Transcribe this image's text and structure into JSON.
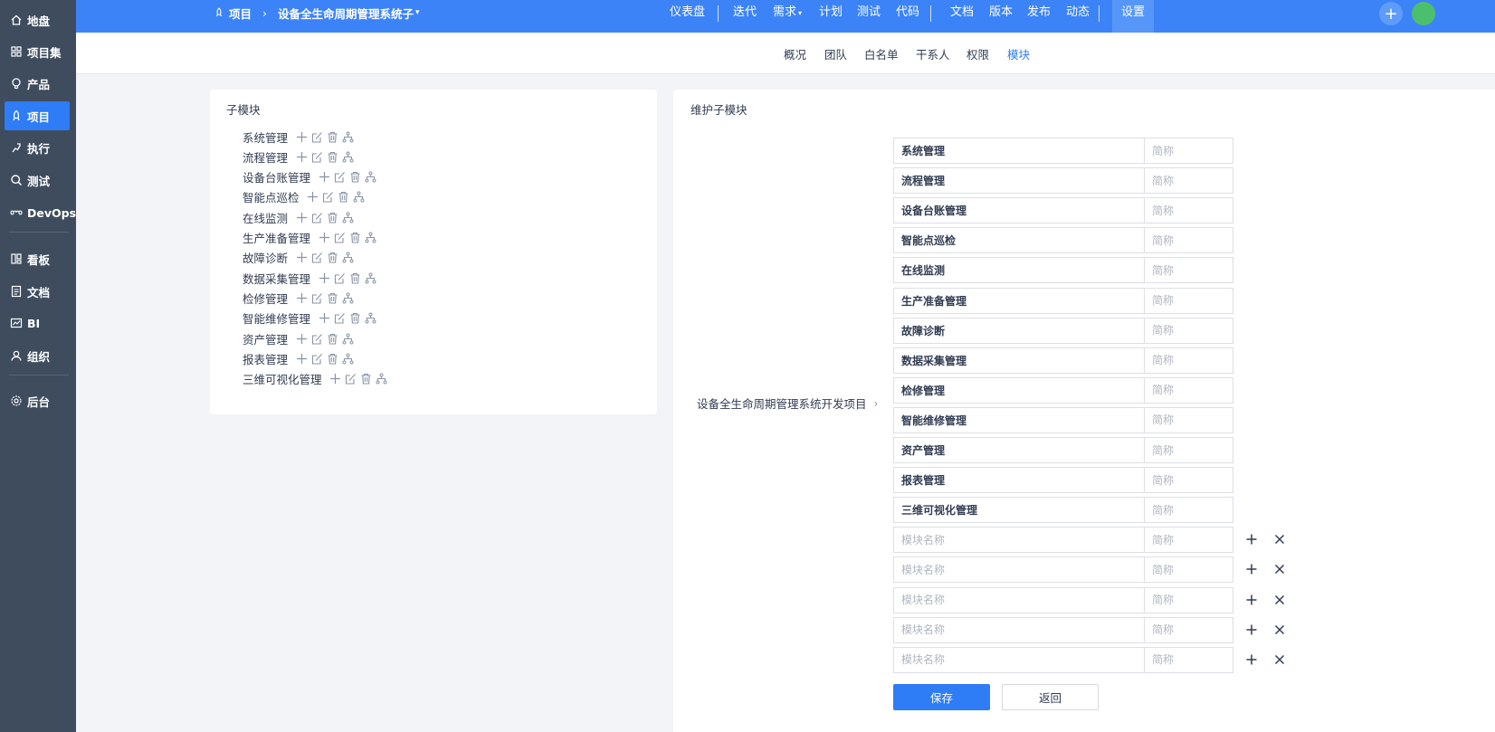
{
  "sidebar": {
    "items": [
      {
        "label": "地盘",
        "icon": "home-icon"
      },
      {
        "label": "项目集",
        "icon": "grid-icon"
      },
      {
        "label": "产品",
        "icon": "bulb-icon"
      },
      {
        "label": "项目",
        "icon": "rocket-icon",
        "active": true
      },
      {
        "label": "执行",
        "icon": "run-icon"
      },
      {
        "label": "测试",
        "icon": "search-icon"
      },
      {
        "label": "DevOps",
        "icon": "infinity-icon"
      },
      {
        "label": "看板",
        "icon": "kanban-icon"
      },
      {
        "label": "文档",
        "icon": "doc-icon"
      },
      {
        "label": "BI",
        "icon": "chart-icon"
      },
      {
        "label": "组织",
        "icon": "people-icon"
      },
      {
        "label": "后台",
        "icon": "gear-icon"
      }
    ]
  },
  "topbar": {
    "breadcrumb_root": "项目",
    "breadcrumb_project": "设备全生命周期管理系统子",
    "nav": [
      "仪表盘",
      "迭代",
      "需求",
      "计划",
      "测试",
      "代码",
      "文档",
      "版本",
      "发布",
      "动态",
      "设置"
    ],
    "active_nav": "设置"
  },
  "subnav": {
    "items": [
      "概况",
      "团队",
      "白名单",
      "干系人",
      "权限",
      "模块"
    ],
    "active": "模块"
  },
  "left_panel": {
    "title": "子模块",
    "modules": [
      "系统管理",
      "流程管理",
      "设备台账管理",
      "智能点巡检",
      "在线监测",
      "生产准备管理",
      "故障诊断",
      "数据采集管理",
      "检修管理",
      "智能维修管理",
      "资产管理",
      "报表管理",
      "三维可视化管理"
    ]
  },
  "right_panel": {
    "title": "维护子模块",
    "parent": "设备全生命周期管理系统开发项目",
    "rows": [
      {
        "name": "系统管理",
        "short": ""
      },
      {
        "name": "流程管理",
        "short": ""
      },
      {
        "name": "设备台账管理",
        "short": ""
      },
      {
        "name": "智能点巡检",
        "short": ""
      },
      {
        "name": "在线监测",
        "short": ""
      },
      {
        "name": "生产准备管理",
        "short": ""
      },
      {
        "name": "故障诊断",
        "short": ""
      },
      {
        "name": "数据采集管理",
        "short": ""
      },
      {
        "name": "检修管理",
        "short": ""
      },
      {
        "name": "智能维修管理",
        "short": ""
      },
      {
        "name": "资产管理",
        "short": ""
      },
      {
        "name": "报表管理",
        "short": ""
      },
      {
        "name": "三维可视化管理",
        "short": ""
      }
    ],
    "new_rows_count": 5,
    "name_placeholder": "模块名称",
    "short_placeholder": "简称",
    "save_label": "保存",
    "back_label": "返回"
  },
  "colors": {
    "sidebar_bg": "#3e4c5e",
    "topbar_bg": "#3c83f7",
    "accent": "#2e7cf6"
  }
}
